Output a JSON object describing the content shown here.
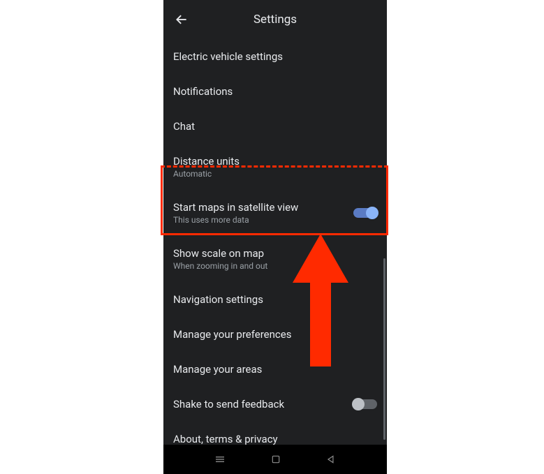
{
  "page": {
    "title": "Settings"
  },
  "settings": {
    "items": [
      {
        "title": "Electric vehicle settings",
        "subtitle": null,
        "toggle": null
      },
      {
        "title": "Notifications",
        "subtitle": null,
        "toggle": null
      },
      {
        "title": "Chat",
        "subtitle": null,
        "toggle": null
      },
      {
        "title": "Distance units",
        "subtitle": "Automatic",
        "toggle": null
      },
      {
        "title": "Start maps in satellite view",
        "subtitle": "This uses more data",
        "toggle": "on"
      },
      {
        "title": "Show scale on map",
        "subtitle": "When zooming in and out",
        "toggle": null
      },
      {
        "title": "Navigation settings",
        "subtitle": null,
        "toggle": null
      },
      {
        "title": "Manage your preferences",
        "subtitle": null,
        "toggle": null
      },
      {
        "title": "Manage your areas",
        "subtitle": null,
        "toggle": null
      },
      {
        "title": "Shake to send feedback",
        "subtitle": null,
        "toggle": "off"
      },
      {
        "title": "About, terms & privacy",
        "subtitle": null,
        "toggle": null
      }
    ]
  },
  "annotation": {
    "highlight_color": "#ff2a00",
    "arrow_color": "#ff2a00"
  }
}
